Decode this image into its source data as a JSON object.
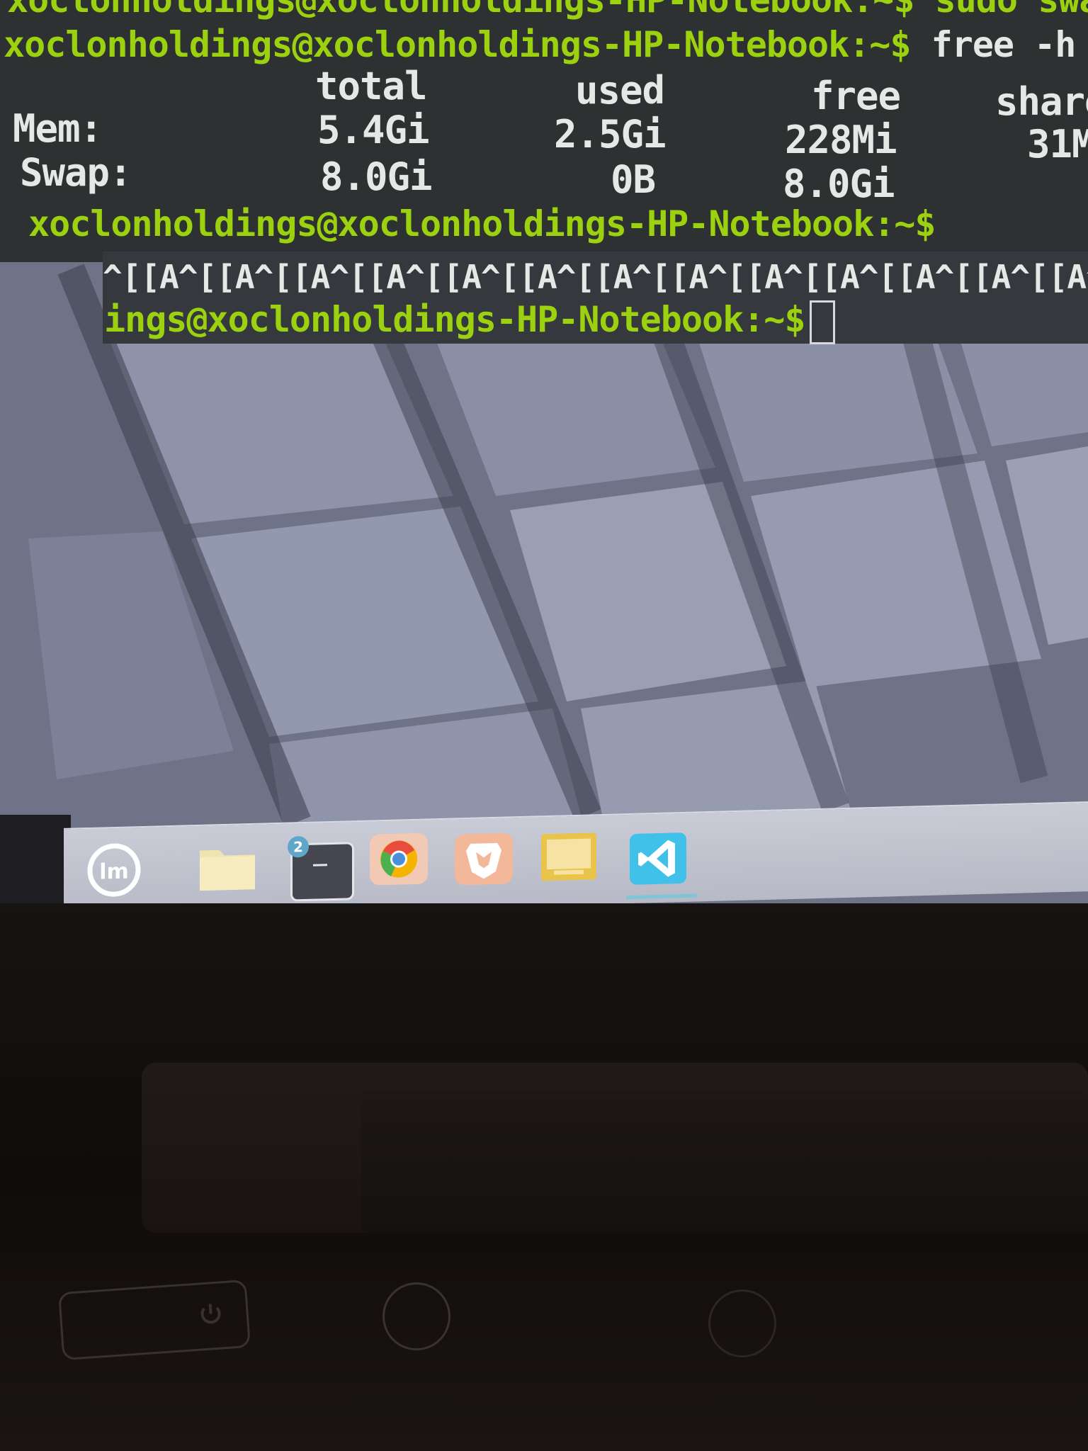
{
  "terminal": {
    "top_partial_line": "xoclonholdings@xoclonholdings-HP-Notebook:~$ sudo swap",
    "prompt1": "xoclonholdings@xoclonholdings-HP-Notebook:~$",
    "command1": " free -h",
    "headers": [
      "total",
      "used",
      "free",
      "share"
    ],
    "rows": [
      {
        "label": "Mem:",
        "total": "5.4Gi",
        "used": "2.5Gi",
        "free": "228Mi",
        "shared": "31M"
      },
      {
        "label": "Swap:",
        "total": "8.0Gi",
        "used": "0B",
        "free": "8.0Gi",
        "shared": ""
      }
    ],
    "prompt2": "xoclonholdings@xoclonholdings-HP-Notebook:~$",
    "escape_line": "^[[A^[[A^[[A^[[A^[[A^[[A^[[A^[[A^[[A^[[A^[[A^[[A^[[A^",
    "prompt3": "ings@xoclonholdings-HP-Notebook:~$"
  },
  "taskbar": {
    "items": [
      {
        "name": "linux-mint-menu-icon",
        "label": "lm"
      },
      {
        "name": "files-folder-icon",
        "label": ""
      },
      {
        "name": "terminal-icon",
        "label": "2"
      },
      {
        "name": "chrome-icon",
        "label": ""
      },
      {
        "name": "brave-icon",
        "label": ""
      },
      {
        "name": "notes-icon",
        "label": ""
      },
      {
        "name": "vscode-icon",
        "label": ""
      }
    ]
  },
  "colors": {
    "prompt_green": "#9bd10e",
    "terminal_bg": "#2e3132",
    "text": "#e6e8e6"
  }
}
